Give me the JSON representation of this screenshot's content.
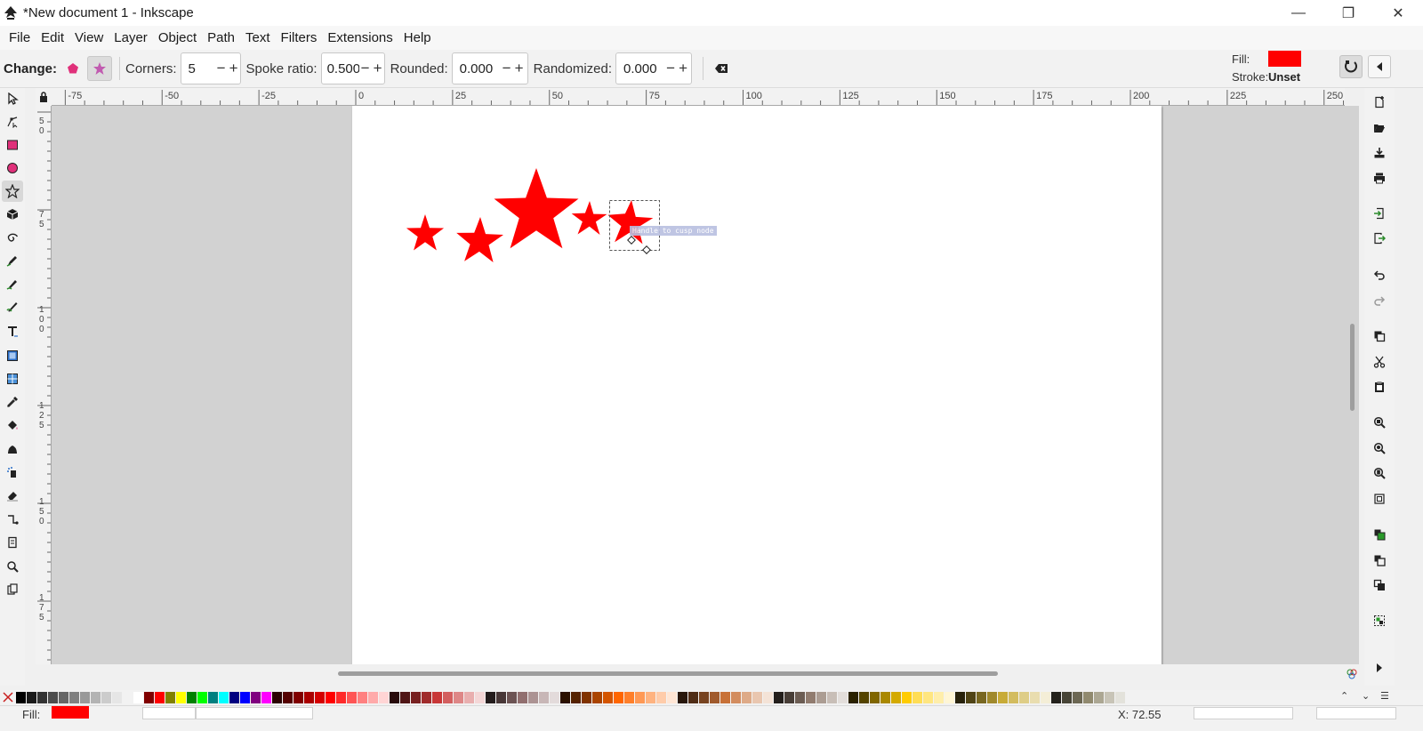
{
  "window": {
    "title": "*New document 1 - Inkscape",
    "minimize": "—",
    "restore": "❐",
    "close": "✕"
  },
  "menu": [
    "File",
    "Edit",
    "View",
    "Layer",
    "Object",
    "Path",
    "Text",
    "Filters",
    "Extensions",
    "Help"
  ],
  "toolctrl": {
    "change_label": "Change:",
    "corners_label": "Corners:",
    "corners_value": "5",
    "spoke_label": "Spoke ratio:",
    "spoke_value": "0.500",
    "rounded_label": "Rounded:",
    "rounded_value": "0.000",
    "randomized_label": "Randomized:",
    "randomized_value": "0.000",
    "minus": "−",
    "plus": "+"
  },
  "style_indicator": {
    "fill_label": "Fill:",
    "fill_color": "#ff0000",
    "stroke_label": "Stroke:",
    "stroke_value": "Unset"
  },
  "ruler": {
    "h_labels": [
      "-75",
      "-50",
      "-25",
      "0",
      "25",
      "50",
      "75",
      "100",
      "125",
      "150",
      "175",
      "200",
      "225",
      "250"
    ],
    "v_labels": [
      "5\n0",
      "7\n5",
      "1\n0\n0",
      "1\n2\n5",
      "1\n5\n0",
      "1\n7\n5"
    ]
  },
  "canvas": {
    "fill_color": "#ff0000",
    "tooltip": "Handle to cusp node"
  },
  "palette": {
    "colors": [
      "#000000",
      "#1a1a1a",
      "#333333",
      "#4d4d4d",
      "#666666",
      "#808080",
      "#999999",
      "#b3b3b3",
      "#cccccc",
      "#e6e6e6",
      "#f2f2f2",
      "#ffffff",
      "#800000",
      "#ff0000",
      "#808000",
      "#ffff00",
      "#008000",
      "#00ff00",
      "#008080",
      "#00ffff",
      "#000080",
      "#0000ff",
      "#800080",
      "#ff00ff",
      "#2b0000",
      "#550000",
      "#800000",
      "#aa0000",
      "#d40000",
      "#ff0000",
      "#ff2a2a",
      "#ff5555",
      "#ff8080",
      "#ffaaaa",
      "#ffd5d5",
      "#280b0b",
      "#501616",
      "#782121",
      "#a02c2c",
      "#c83737",
      "#d35f5f",
      "#de8787",
      "#e9afaf",
      "#f4d7d7",
      "#241c1c",
      "#483737",
      "#6c5353",
      "#916f6f",
      "#ac9393",
      "#c8b7b7",
      "#e3dbdb",
      "#2b1100",
      "#552200",
      "#803300",
      "#aa4400",
      "#d45500",
      "#ff6600",
      "#ff7f2a",
      "#ff9955",
      "#ffb380",
      "#ffccaa",
      "#ffe6d5",
      "#28170b",
      "#502d16",
      "#784421",
      "#a05a2c",
      "#c87137",
      "#d38d5f",
      "#deaa87",
      "#e9c6af",
      "#f4e3d7",
      "#241f1c",
      "#483e37",
      "#6c5d53",
      "#917c6f",
      "#ac9d93",
      "#c8beb7",
      "#e3dedb",
      "#2b2200",
      "#554400",
      "#806600",
      "#aa8800",
      "#d4aa00",
      "#ffcc00",
      "#ffdd55",
      "#ffe680",
      "#ffeeaa",
      "#fff6d5",
      "#28220b",
      "#504416",
      "#786721",
      "#a0892c",
      "#c8ab37",
      "#d3bc5f",
      "#decd87",
      "#e9ddaf",
      "#f4eed7",
      "#24221c",
      "#484537",
      "#6c6753",
      "#918a6f",
      "#aca793",
      "#c8c4b7",
      "#e3e2db"
    ]
  },
  "status": {
    "fill_label": "Fill:",
    "fill_color": "#ff0000",
    "coords": "X:   72.55"
  }
}
